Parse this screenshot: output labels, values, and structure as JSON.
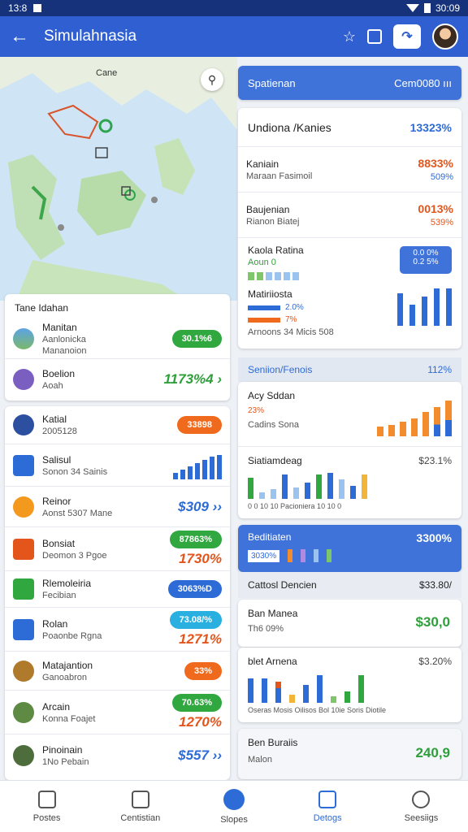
{
  "status": {
    "left": "13:8",
    "right": "30:09"
  },
  "app": {
    "title": "Simulahnasia",
    "back_icon": "arrow-left-icon"
  },
  "map": {
    "label": "Cane"
  },
  "left_top": {
    "title": "Tane Idahan",
    "items": [
      {
        "title": "Manitan",
        "sub1": "Aanlonicka",
        "sub2": "Mananoion",
        "value": "30.1%6"
      },
      {
        "title": "Boelion",
        "sub1": "Aoah",
        "value": "1173%4 ›"
      }
    ]
  },
  "left_list": [
    {
      "title": "Katial",
      "sub": "2005128",
      "value": "33898"
    },
    {
      "title": "Salisul",
      "sub": "Sonon 34 Sainis",
      "bars": [
        8,
        12,
        16,
        20,
        24,
        28,
        30
      ]
    },
    {
      "title": "Reinor",
      "sub": "Aonst 5307 Mane",
      "value": "$309 ››"
    },
    {
      "title": "Bonsiat",
      "sub": "Deomon 3 Pgoe",
      "value1": "87863%",
      "value2": "1730%"
    },
    {
      "title": "Rlemoleiria",
      "sub": "Fecibian",
      "value": "3063%D"
    },
    {
      "title": "Rolan",
      "sub": "Poaonbe Rgna",
      "value1": "73.08/%",
      "value2": "1271%"
    },
    {
      "title": "Matajantion",
      "sub": "Ganoabron",
      "value": "33%"
    },
    {
      "title": "Arcain",
      "sub": "Konna Foajet",
      "value1": "70.63%",
      "value2": "1270%"
    },
    {
      "title": "Pinoinain",
      "sub": "1No Pebain",
      "value": "$557 ››"
    }
  ],
  "right_header": {
    "left": "Spatienan",
    "right": "Cem0080 ııı"
  },
  "right_stats": {
    "header_left": "Undiona /Kanies",
    "header_right": "13323%",
    "rows": [
      {
        "title": "Kaniain",
        "sub": "Maraan Fasimoil",
        "value": "8833%",
        "value2": "509%"
      },
      {
        "title": "Baujenian",
        "sub": "Rianon Biatej",
        "value": "0013%",
        "value2": "539%"
      },
      {
        "title": "Kaola Ratina",
        "sub": "Aoun 0",
        "box": "0.0 0%\n0.2 5%"
      },
      {
        "title": "Matiriiosta",
        "sub": "Arnoons 34 Micis 508",
        "value": "2.0%",
        "value2": "7%"
      }
    ]
  },
  "right_section": {
    "left": "Seniion/Fenois",
    "right": "112%"
  },
  "right_charts": [
    {
      "title": "Acy Sddan",
      "sub": "Cadins Sona",
      "value": "23%"
    },
    {
      "title": "Siatiamdeag",
      "value": "$23.1%",
      "axis": "0 0 10 10 Pacioniera 10 10 0"
    }
  ],
  "blue_card": {
    "left": "Beditiaten",
    "right": "3300%",
    "sub": "3030%"
  },
  "control_row": {
    "left": "Cattosl Dencien",
    "right": "$33.80/"
  },
  "bon_card": {
    "title": "Ban Manea",
    "sub": "Th6 09%",
    "value": "$30,0"
  },
  "blet_card": {
    "title": "blet Arnena",
    "value": "$3.20%",
    "labels": "Oseras Mosis Oilisos Bol 10ie Soris Diotile"
  },
  "ben_card": {
    "title": "Ben Buraiis",
    "sub": "Malon",
    "value": "240,9"
  },
  "tabs": [
    {
      "label": "Postes"
    },
    {
      "label": "Centistian"
    },
    {
      "label": "Slopes"
    },
    {
      "label": "Detogs"
    },
    {
      "label": "Seesiigs"
    }
  ]
}
